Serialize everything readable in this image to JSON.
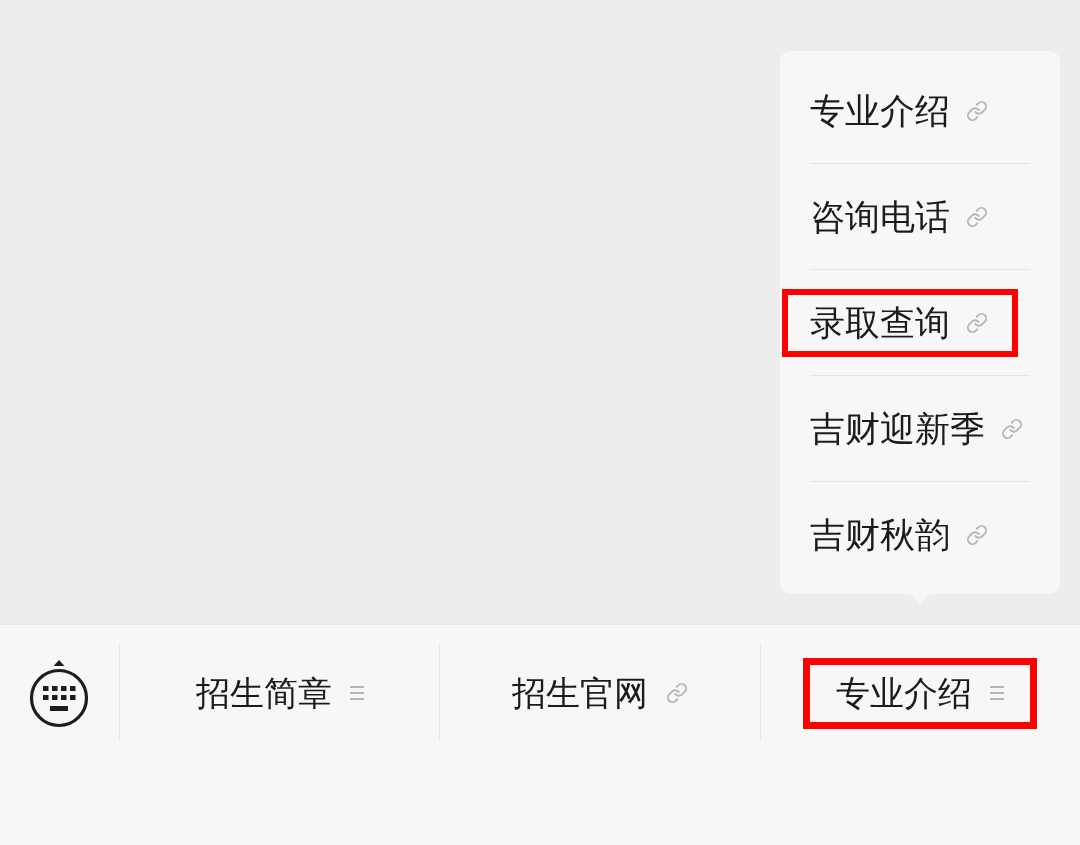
{
  "menu_bar": {
    "items": [
      {
        "label": "招生简章",
        "kind": "submenu",
        "highlighted": false,
        "expanded": false
      },
      {
        "label": "招生官网",
        "kind": "link",
        "highlighted": false,
        "expanded": false
      },
      {
        "label": "专业介绍",
        "kind": "submenu",
        "highlighted": true,
        "expanded": true,
        "children": [
          {
            "label": "专业介绍",
            "kind": "link",
            "highlighted": false
          },
          {
            "label": "咨询电话",
            "kind": "link",
            "highlighted": false
          },
          {
            "label": "录取查询",
            "kind": "link",
            "highlighted": true
          },
          {
            "label": "吉财迎新季",
            "kind": "link",
            "highlighted": false
          },
          {
            "label": "吉财秋韵",
            "kind": "link",
            "highlighted": false
          }
        ]
      }
    ]
  }
}
